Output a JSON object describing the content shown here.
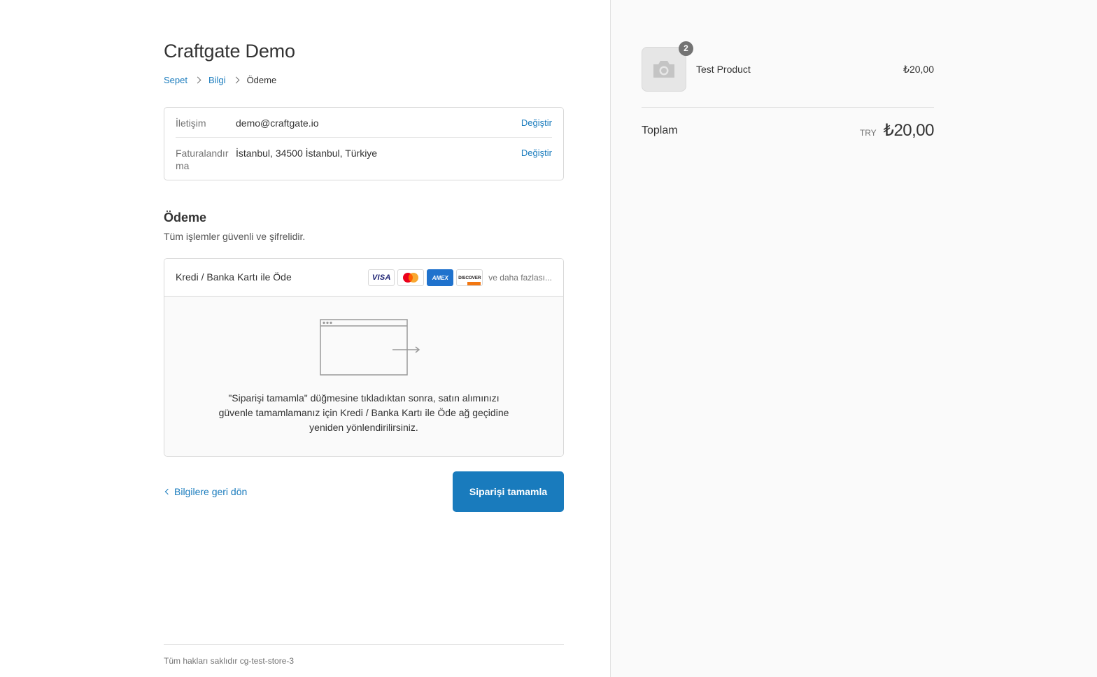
{
  "store": {
    "title": "Craftgate Demo"
  },
  "breadcrumb": {
    "cart": "Sepet",
    "info": "Bilgi",
    "payment": "Ödeme"
  },
  "review": {
    "contact_label": "İletişim",
    "contact_value": "demo@craftgate.io",
    "billing_label": "Faturalandırma",
    "billing_value": "İstanbul, 34500 İstanbul, Türkiye",
    "change_label": "Değiştir"
  },
  "payment": {
    "title": "Ödeme",
    "subtitle": "Tüm işlemler güvenli ve şifrelidir.",
    "method_label": "Kredi / Banka Kartı ile Öde",
    "cards": {
      "visa": "VISA",
      "amex": "AMEX",
      "discover": "DISCOVER"
    },
    "more_cards": "ve daha fazlası...",
    "redirect_text": "\"Siparişi tamamla\" düğmesine tıkladıktan sonra, satın alımınızı güvenle tamamlamanız için Kredi / Banka Kartı ile Öde ağ geçidine yeniden yönlendirilirsiniz."
  },
  "actions": {
    "back_label": "Bilgilere geri dön",
    "complete_label": "Siparişi tamamla"
  },
  "footer": {
    "text": "Tüm hakları saklıdır cg-test-store-3"
  },
  "summary": {
    "product_name": "Test Product",
    "product_price": "₺20,00",
    "quantity": "2",
    "total_label": "Toplam",
    "total_currency": "TRY",
    "total_value": "₺20,00"
  },
  "colors": {
    "accent": "#197bbd",
    "sidebar_bg": "#fafafa",
    "border": "#d9d9d9"
  }
}
